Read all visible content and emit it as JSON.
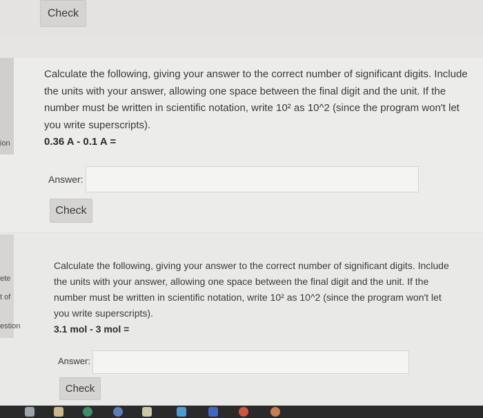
{
  "top": {
    "check_label": "Check"
  },
  "sidebar": {
    "items": [
      "ion",
      "ete",
      "t of",
      "estion"
    ]
  },
  "questions": [
    {
      "lines": [
        "Calculate the following, giving your answer to the correct number of significant digits. Include",
        "the units with your answer, allowing one space between the final digit and the unit. If the",
        "number must be written in scientific notation, write 10² as 10^2 (since the program won't let",
        "you write superscripts)."
      ],
      "expression": "0.36 A - 0.1 A =",
      "answer_label": "Answer:",
      "answer_value": "",
      "check_label": "Check"
    },
    {
      "lines": [
        "Calculate the following, giving your answer to the correct number of significant digits. Include",
        "the units with your answer, allowing one space between the final digit and the unit. If the",
        "number must be written in scientific notation, write 10² as 10^2 (since the program won't let",
        "you write superscripts)."
      ],
      "expression": "3.1 mol - 3 mol =",
      "answer_label": "Answer:",
      "answer_value": "",
      "check_label": "Check"
    }
  ],
  "taskbar": {
    "icons": [
      "finder-icon",
      "launchpad-icon",
      "chrome-icon",
      "files-icon",
      "notes-icon",
      "calendar-icon",
      "keynote-icon",
      "swift-icon",
      "safari-icon"
    ]
  }
}
